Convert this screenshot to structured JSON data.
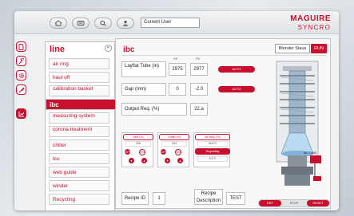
{
  "topbar": {
    "user_label": "Current User",
    "brand_main": "MAGUIRE",
    "brand_sub": "SYNCRO",
    "icons": [
      "home-icon",
      "keyboard-icon",
      "search-icon",
      "user-icon"
    ]
  },
  "sidebar_icons": [
    "document-icon",
    "wrench-icon",
    "gear-icon",
    "paint-icon",
    "chart-icon"
  ],
  "menu": {
    "title": "line",
    "items": [
      {
        "label": "air ring"
      },
      {
        "label": "haul off"
      },
      {
        "label": "calibration basket"
      },
      {
        "label": "ibc"
      },
      {
        "label": "measuring system"
      },
      {
        "label": "corona treatment"
      },
      {
        "label": "chiller"
      },
      {
        "label": "tcu"
      },
      {
        "label": "web guide"
      },
      {
        "label": "winder"
      },
      {
        "label": "Recycling"
      }
    ]
  },
  "panel": {
    "title": "ibc",
    "blender_status": "Blender Staus",
    "run_label": "RUN",
    "col_sp": "SP",
    "col_pv": "PV",
    "rows": [
      {
        "label": "Layflat Tube (in)",
        "sp": "2975",
        "pv": "2977",
        "action": "AUTO"
      },
      {
        "label": "Gap (mm)",
        "sp": "0",
        "pv": "-2.0",
        "action": "AUTO"
      },
      {
        "label": "Output Req. (%)",
        "pv": "22.a"
      }
    ],
    "zones": [
      {
        "title": "Inlet (%)",
        "value": "306",
        "off": "OFF",
        "on": "ON"
      },
      {
        "title": "Outlet (%)",
        "value": "344",
        "off": "OFF",
        "on": "ON"
      },
      {
        "title": "Air temp (%)",
        "value": "35.6°C",
        "mode": "Regulating",
        "value2": "8.6°C"
      }
    ],
    "recipe_id_label": "Recipe ID",
    "recipe_id": "1",
    "recipe_desc_label": "Recipe Description",
    "recipe_desc": "TEST",
    "controls": {
      "left": "DEF",
      "middle": "STOP",
      "right": "RESET"
    },
    "machine_label": "IBC TUBE"
  },
  "colors": {
    "accent": "#c8102e"
  }
}
